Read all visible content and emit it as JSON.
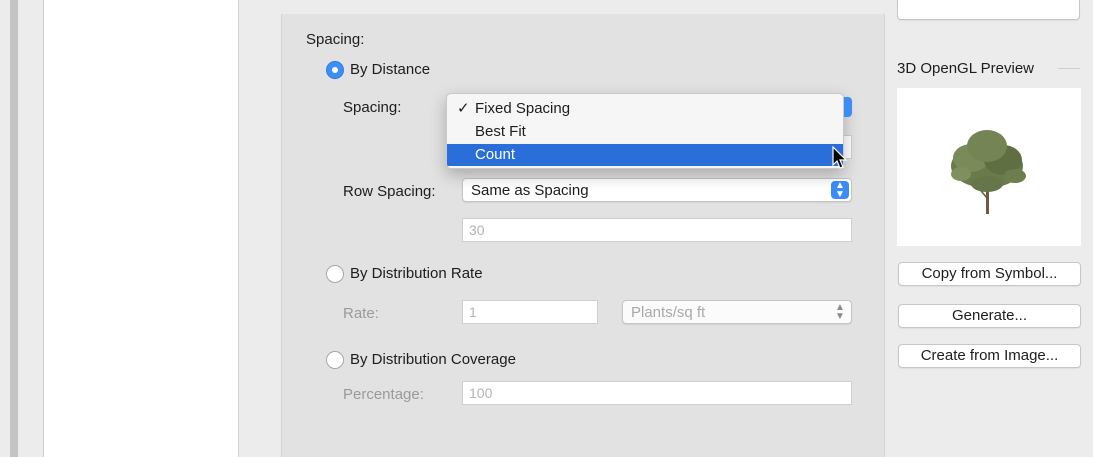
{
  "spacing_section": {
    "heading": "Spacing:",
    "by_distance_label": "By Distance",
    "spacing_label": "Spacing:",
    "row_spacing_label": "Row Spacing:",
    "row_spacing_value": "Same as Spacing",
    "row_spacing_field": "30"
  },
  "dropdown": {
    "items": [
      {
        "label": "Fixed Spacing",
        "checked": true
      },
      {
        "label": "Best Fit",
        "checked": false
      },
      {
        "label": "Count",
        "checked": false
      }
    ],
    "check_glyph": "✓"
  },
  "distribution_rate": {
    "label": "By Distribution Rate",
    "rate_label": "Rate:",
    "rate_value": "1",
    "unit": "Plants/sq ft"
  },
  "distribution_coverage": {
    "label": "By Distribution Coverage",
    "percentage_label": "Percentage:",
    "percentage_value": "100"
  },
  "right_panel": {
    "preview_title": "3D OpenGL Preview",
    "copy_button": "Copy from Symbol...",
    "generate_button": "Generate...",
    "create_button": "Create from Image..."
  },
  "colors": {
    "accent": "#3b8df5",
    "highlight": "#2a6fd9"
  }
}
